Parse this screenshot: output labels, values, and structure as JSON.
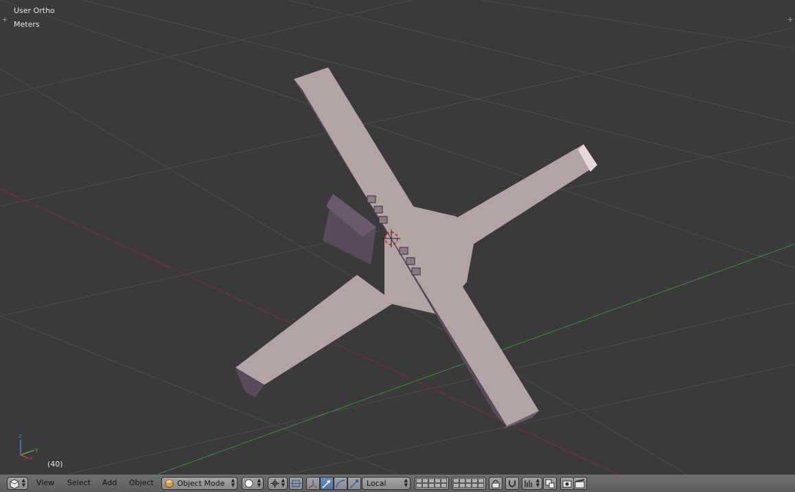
{
  "viewport": {
    "view_name": "User Ortho",
    "units": "Meters",
    "frame": "(40)",
    "axis_labels": {
      "x": "x",
      "y": "y",
      "z": "z"
    },
    "colors": {
      "background": "#3a3a3a",
      "grid": "#4a4a4a",
      "x_axis": "#8b2e2e",
      "y_axis": "#3f8f3f",
      "model_face": "#b3a3a3",
      "model_shadow": "#5a4b5c"
    }
  },
  "header": {
    "editor_type_icon": "3d-view-icon",
    "menus": [
      "View",
      "Select",
      "Add",
      "Object"
    ],
    "mode": {
      "icon": "object-cube-icon",
      "label": "Object Mode"
    },
    "shading": {
      "icon": "solid-sphere-icon"
    },
    "pivot": {
      "icon": "pivot-point-icon"
    },
    "manipulator_icons": [
      "manipulator-toggle-icon",
      "translate-icon",
      "rotate-icon",
      "scale-icon"
    ],
    "orientation": {
      "label": "Local"
    },
    "layer_icons": [
      "layers-grid-icon",
      "layers-grid-icon"
    ],
    "tool_icons": [
      "lock-icon",
      "magnet-icon",
      "snap-element-icon",
      "snap-target-icon",
      "render-still-icon",
      "render-anim-icon"
    ]
  }
}
